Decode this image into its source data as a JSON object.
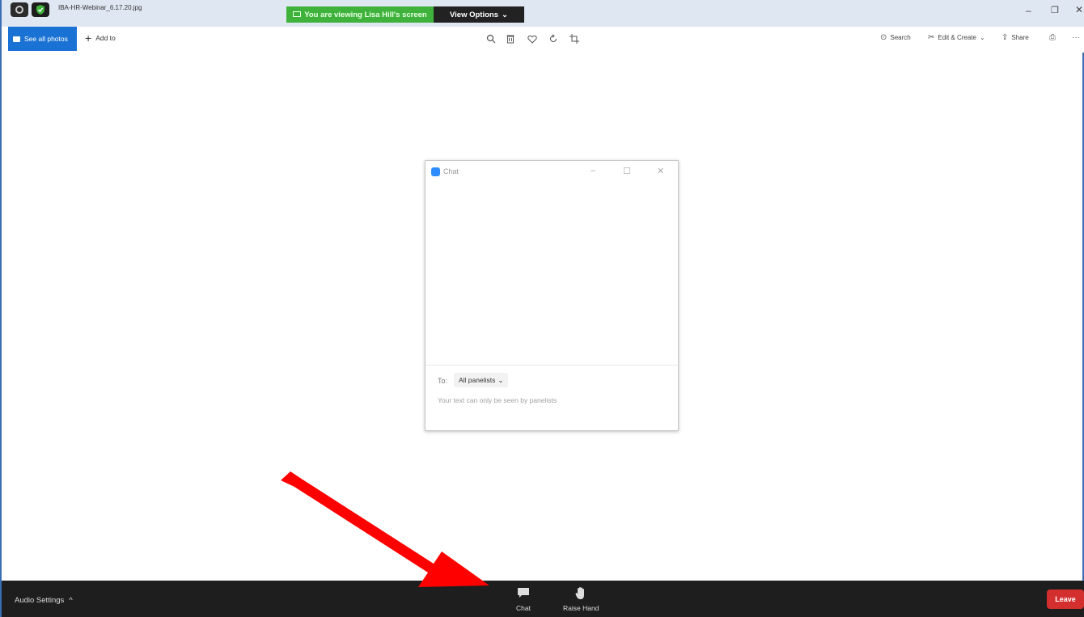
{
  "window": {
    "file_title": "IBA-HR-Webinar_6.17.20.jpg",
    "minimize_glyph": "–",
    "maximize_glyph": "❐",
    "close_glyph": "✕"
  },
  "share_banner": {
    "text": "You are viewing Lisa Hill's screen",
    "view_options_label": "View Options",
    "view_options_caret": "⌄"
  },
  "photos_toolbar": {
    "see_all_label": "See all photos",
    "add_to_label": "Add to",
    "add_to_glyph": "+",
    "center_icons": [
      "zoom-icon",
      "trash-icon",
      "heart-icon",
      "rotate-icon",
      "crop-icon"
    ],
    "search_label": "Search",
    "edit_create_label": "Edit & Create",
    "share_label": "Share",
    "more_glyph": "···"
  },
  "chat_window": {
    "title": "Chat",
    "to_label": "To:",
    "recipient_label": "All panelists",
    "recipient_caret": "⌄",
    "hint": "Your text can only be seen by panelists"
  },
  "meeting_bar": {
    "audio_settings_label": "Audio Settings",
    "audio_caret": "^",
    "chat_label": "Chat",
    "raise_hand_label": "Raise Hand",
    "leave_label": "Leave"
  },
  "colors": {
    "banner_green": "#3fb23c",
    "see_all_blue": "#1a73d4",
    "leave_red": "#d32f2f",
    "arrow_red": "#ff0000",
    "bottom_bar": "#1e1e1e"
  }
}
